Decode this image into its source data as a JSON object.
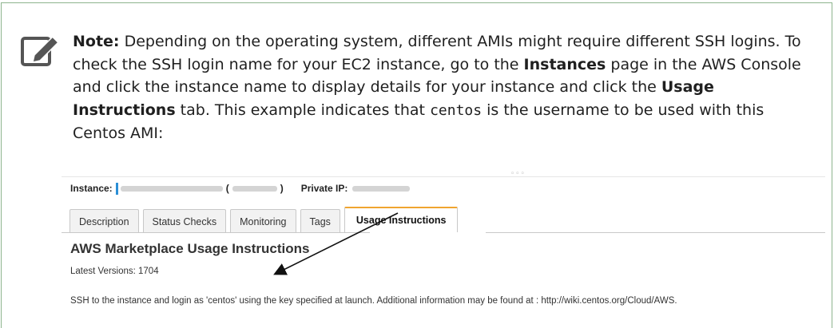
{
  "note": {
    "icon": "edit-note-icon",
    "label": "Note:",
    "seg1": " Depending on the operating system, different AMIs might require different SSH logins. To check the SSH login name for your EC2 instance, go to the ",
    "instances_bold": "Instances",
    "seg2": " page in the AWS Console and click the instance name to display details for your instance and click the ",
    "usage_bold": "Usage Instructions",
    "seg3": " tab. This example indicates that ",
    "code": "centos",
    "seg4": " is the username to be used with this Centos AMI:"
  },
  "console": {
    "dots": "◦◦◦",
    "instance_label": "Instance:",
    "open_paren": "(",
    "close_paren": ")",
    "private_ip_label": "Private IP:",
    "tabs": [
      "Description",
      "Status Checks",
      "Monitoring",
      "Tags",
      "Usage Instructions"
    ],
    "active_tab": "Usage Instructions",
    "heading": "AWS Marketplace Usage Instructions",
    "versions": "Latest Versions: 1704",
    "ssh_text": "SSH to the instance and login as 'centos' using the key specified at launch. Additional information may be found at : http://wiki.centos.org/Cloud/AWS."
  },
  "colors": {
    "border": "#8db48e",
    "active_tab_accent": "#f0a530",
    "instance_marker": "#2b8fd6"
  }
}
